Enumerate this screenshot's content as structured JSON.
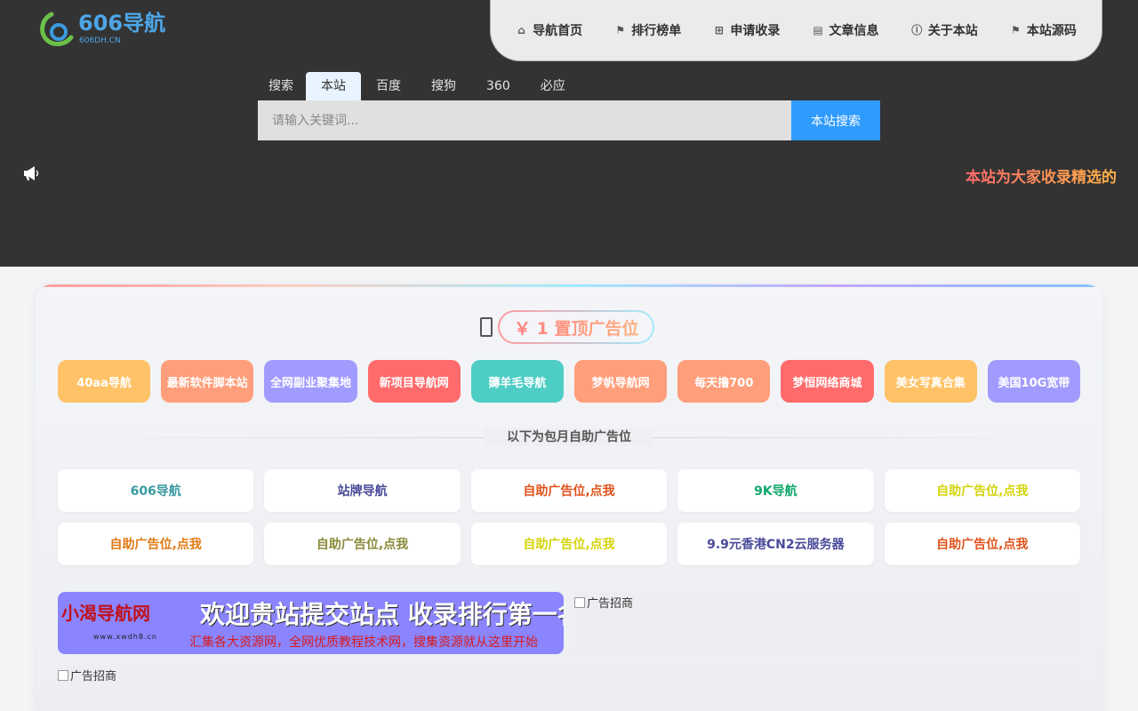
{
  "header": {
    "logo": {
      "text": "606导航",
      "sub": "606DH.CN"
    },
    "nav": [
      {
        "label": "导航首页",
        "icon": "home-icon"
      },
      {
        "label": "排行榜单",
        "icon": "flag-icon"
      },
      {
        "label": "申请收录",
        "icon": "plus-square-icon"
      },
      {
        "label": "文章信息",
        "icon": "book-icon"
      },
      {
        "label": "关于本站",
        "icon": "info-circle-icon"
      },
      {
        "label": "本站源码",
        "icon": "flag-icon"
      }
    ]
  },
  "search": {
    "tabs": [
      "搜索",
      "本站",
      "百度",
      "搜狗",
      "360",
      "必应"
    ],
    "active_tab": "本站",
    "placeholder": "请输入关键词...",
    "button_label": "本站搜索"
  },
  "notice": {
    "icon": "megaphone-icon",
    "text": "本站为大家收录精选的"
  },
  "top_ad": {
    "icon": "mobile-icon",
    "label": "￥ 1  置顶广告位"
  },
  "featured": [
    {
      "label": "40aa导航",
      "color": "#ffc266"
    },
    {
      "label": "最新软件脚本站",
      "color": "#ff9e7a"
    },
    {
      "label": "全网副业聚集地",
      "color": "#a29bfe"
    },
    {
      "label": "新项目导航网",
      "color": "#ff6b6b"
    },
    {
      "label": "薅羊毛导航",
      "color": "#4ecdc4"
    },
    {
      "label": "梦帆导航网",
      "color": "#ff9e7a"
    },
    {
      "label": "每天撸700",
      "color": "#ff9e7a"
    },
    {
      "label": "梦恒网络商城",
      "color": "#ff6b6b"
    },
    {
      "label": "美女写真合集",
      "color": "#ffc266"
    },
    {
      "label": "美国10G宽带",
      "color": "#a29bfe"
    }
  ],
  "monthly": {
    "title": "以下为包月自助广告位",
    "items": [
      {
        "label": "606导航",
        "color": "#3a9aa0"
      },
      {
        "label": "站牌导航",
        "color": "#4a4a9a"
      },
      {
        "label": "自助广告位,点我",
        "color": "#e0521b"
      },
      {
        "label": "9K导航",
        "color": "#11a86c"
      },
      {
        "label": "自助广告位,点我",
        "color": "#d4d40a"
      },
      {
        "label": "自助广告位,点我",
        "color": "#e07a14"
      },
      {
        "label": "自助广告位,点我",
        "color": "#8a8a3a"
      },
      {
        "label": "自助广告位,点我",
        "color": "#d4d40a"
      },
      {
        "label": "9.9元香港CN2云服务器",
        "color": "#4a4a9a"
      },
      {
        "label": "自助广告位,点我",
        "color": "#e0521b"
      }
    ]
  },
  "banners": [
    {
      "type": "image",
      "logo": "小渴导航网",
      "sub": "www.xwdh8.cn",
      "headline": "欢迎贵站提交站点 收录排行第一名",
      "line": "汇集各大资源网，全网优质教程技术网，搜集资源就从这里开始"
    },
    {
      "type": "broken",
      "alt": "广告招商"
    },
    {
      "type": "broken",
      "alt": "广告招商"
    },
    {
      "type": "empty",
      "alt": ""
    }
  ]
}
